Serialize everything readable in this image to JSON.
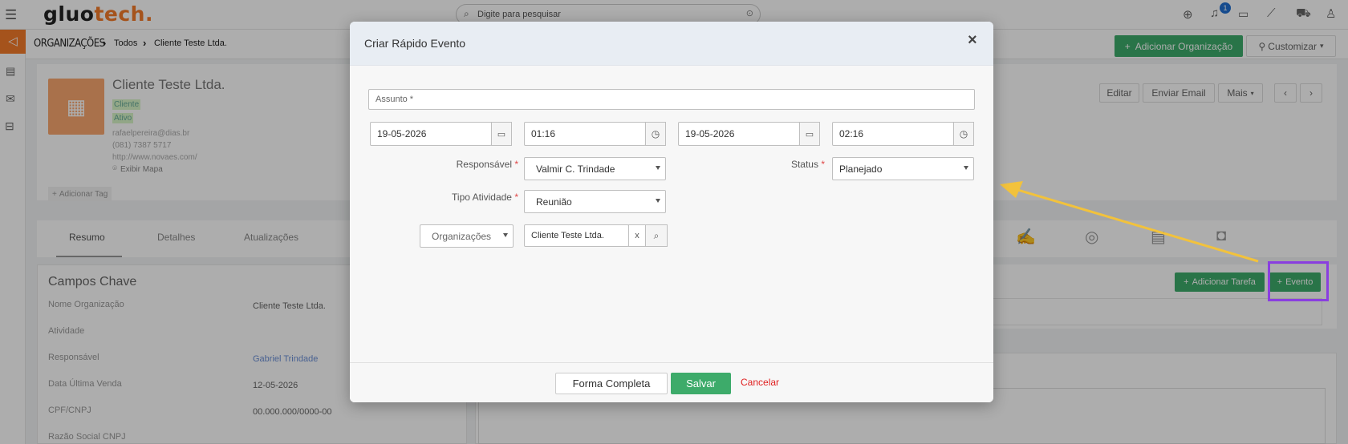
{
  "header": {
    "logo_left": "gluo",
    "logo_accent": "tech",
    "logo_dot": ".",
    "search_placeholder": "Digite para pesquisar",
    "notification_count": "1"
  },
  "breadcrumb": {
    "root": "ORGANIZAÇÕES",
    "level1": "Todos",
    "level2": "Cliente Teste Ltda."
  },
  "header_actions": {
    "add_org": "Adicionar Organização",
    "customize": "Customizar"
  },
  "record": {
    "name": "Cliente Teste Ltda.",
    "tag1": "Cliente",
    "tag2": "Ativo",
    "email": "rafaelpereira@dias.br",
    "phone": "(081) 7387 5717",
    "website": "http://www.novaes.com/",
    "map": "Exibir Mapa",
    "add_tag": "Adicionar Tag"
  },
  "record_actions": {
    "edit": "Editar",
    "send_email": "Enviar Email",
    "more": "Mais"
  },
  "tabs": [
    {
      "label": "Resumo"
    },
    {
      "label": "Detalhes"
    },
    {
      "label": "Atualizações"
    }
  ],
  "key_fields": {
    "title": "Campos Chave",
    "rows": [
      {
        "label": "Nome Organização",
        "value": "Cliente Teste Ltda."
      },
      {
        "label": "Atividade",
        "value": ""
      },
      {
        "label": "Responsável",
        "value": "Gabriel Trindade"
      },
      {
        "label": "Data Última Venda",
        "value": "12-05-2026"
      },
      {
        "label": "CPF/CNPJ",
        "value": "00.000.000/0000-00"
      },
      {
        "label": "Razão Social CNPJ",
        "value": ""
      }
    ]
  },
  "activity_actions": {
    "add_task": "Adicionar Tarefa",
    "event": "Evento"
  },
  "modal": {
    "title": "Criar Rápido Evento",
    "subject_placeholder": "Assunto *",
    "start_date": "19-05-2026",
    "start_time": "01:16",
    "end_date": "19-05-2026",
    "end_time": "02:16",
    "responsible_label": "Responsável",
    "responsible_value": "Valmir C. Trindade",
    "status_label": "Status",
    "status_value": "Planejado",
    "activity_type_label": "Tipo Atividade",
    "activity_type_value": "Reunião",
    "related_module": "Organizações",
    "related_value": "Cliente Teste Ltda.",
    "clear_label": "x",
    "required_mark": "*",
    "full_form": "Forma Completa",
    "save": "Salvar",
    "cancel": "Cancelar"
  },
  "colors": {
    "brand_orange": "#f47b2a",
    "green": "#3dab6a",
    "highlight_purple": "#8a3ee0",
    "arrow_yellow": "#f2c23c",
    "cancel_red": "#e02020"
  }
}
